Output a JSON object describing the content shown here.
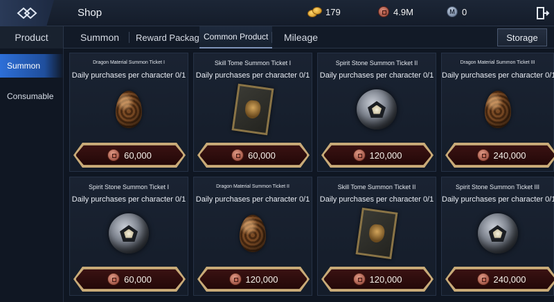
{
  "header": {
    "title": "Shop",
    "currencies": [
      {
        "icon": "gold-coins-icon",
        "value": "179"
      },
      {
        "icon": "copper-coin-icon",
        "value": "4.9M"
      },
      {
        "icon": "mileage-m-icon",
        "value": "0"
      }
    ]
  },
  "tabs": {
    "product": "Product",
    "summon": "Summon",
    "reward": "Reward Package",
    "common": "Common Product",
    "mileage": "Mileage",
    "storage": "Storage"
  },
  "sidebar": {
    "items": [
      {
        "label": "Summon",
        "active": true
      },
      {
        "label": "Consumable",
        "active": false
      }
    ]
  },
  "products": [
    {
      "name": "Dragon Material Summon Ticket I",
      "limit": "Daily purchases per character 0/1",
      "price": "60,000",
      "art": "egg"
    },
    {
      "name": "Skill Tome Summon Ticket I",
      "limit": "Daily purchases per character 0/1",
      "price": "60,000",
      "art": "tome"
    },
    {
      "name": "Spirit Stone Summon Ticket II",
      "limit": "Daily purchases per character 0/1",
      "price": "120,000",
      "art": "stone"
    },
    {
      "name": "Dragon Material Summon Ticket III",
      "limit": "Daily purchases per character 0/1",
      "price": "240,000",
      "art": "egg"
    },
    {
      "name": "Spirit Stone Summon Ticket I",
      "limit": "Daily purchases per character 0/1",
      "price": "60,000",
      "art": "stone"
    },
    {
      "name": "Dragon Material Summon Ticket II",
      "limit": "Daily purchases per character 0/1",
      "price": "120,000",
      "art": "egg"
    },
    {
      "name": "Skill Tome Summon Ticket II",
      "limit": "Daily purchases per character 0/1",
      "price": "120,000",
      "art": "tome"
    },
    {
      "name": "Spirit Stone Summon Ticket III",
      "limit": "Daily purchases per character 0/1",
      "price": "240,000",
      "art": "stone"
    }
  ],
  "colors": {
    "accent": "#2d6fd8",
    "price_frame": "#c9ab78",
    "price_bg": "#2a0c0c"
  }
}
